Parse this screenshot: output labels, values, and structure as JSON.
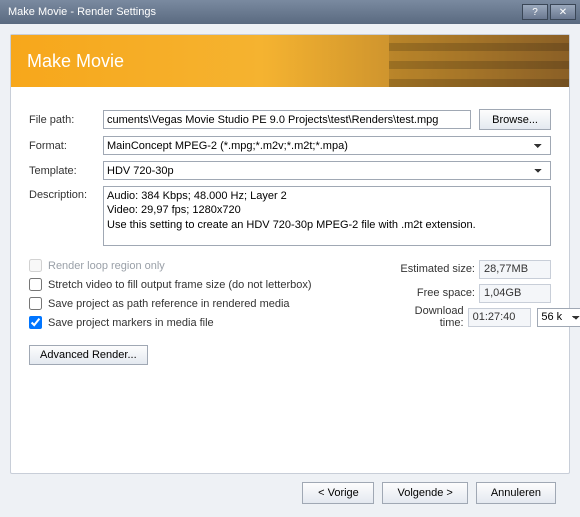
{
  "window": {
    "title": "Make Movie - Render Settings",
    "help": "?",
    "close": "✕"
  },
  "banner": {
    "title": "Make Movie"
  },
  "labels": {
    "file_path": "File path:",
    "format": "Format:",
    "template": "Template:",
    "description": "Description:",
    "browse": "Browse...",
    "estimated_size": "Estimated size:",
    "free_space": "Free space:",
    "download_time": "Download time:"
  },
  "fields": {
    "file_path": "cuments\\Vegas Movie Studio PE 9.0 Projects\\test\\Renders\\test.mpg",
    "format": "MainConcept MPEG-2 (*.mpg;*.m2v;*.m2t;*.mpa)",
    "template": "HDV 720-30p",
    "description": "Audio: 384 Kbps; 48.000 Hz; Layer 2\nVideo: 29,97 fps; 1280x720\nUse this setting to create an HDV 720-30p MPEG-2 file with .m2t extension."
  },
  "checks": {
    "render_loop": "Render loop region only",
    "stretch": "Stretch video to fill output frame size (do not letterbox)",
    "save_path_ref": "Save project as path reference in rendered media",
    "save_markers": "Save project markers in media file"
  },
  "stats": {
    "estimated_size": "28,77MB",
    "free_space": "1,04GB",
    "download_time": "01:27:40",
    "speed": "56 k"
  },
  "buttons": {
    "advanced": "Advanced Render...",
    "back": "< Vorige",
    "next": "Volgende >",
    "cancel": "Annuleren"
  }
}
